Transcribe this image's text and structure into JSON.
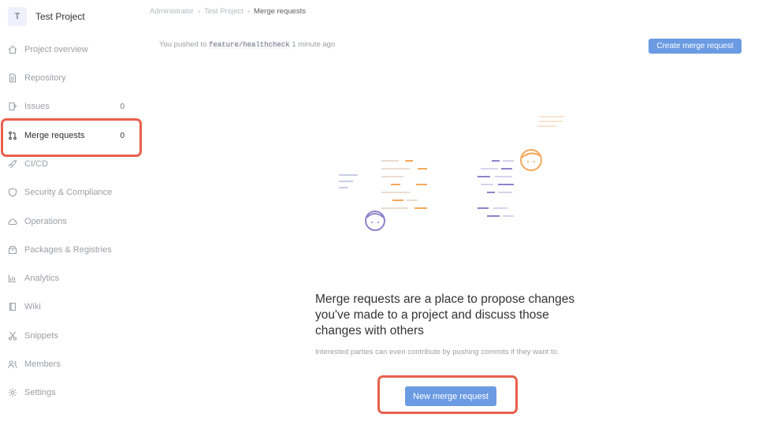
{
  "project": {
    "initial": "T",
    "name": "Test Project"
  },
  "sidebar": {
    "items": [
      {
        "label": "Project overview",
        "icon": "home-icon"
      },
      {
        "label": "Repository",
        "icon": "file-icon"
      },
      {
        "label": "Issues",
        "count": "0",
        "icon": "issues-icon"
      },
      {
        "label": "Merge requests",
        "count": "0",
        "icon": "merge-request-icon",
        "active": true
      },
      {
        "label": "CI/CD",
        "icon": "rocket-icon"
      },
      {
        "label": "Security & Compliance",
        "icon": "shield-icon"
      },
      {
        "label": "Operations",
        "icon": "cloud-icon"
      },
      {
        "label": "Packages & Registries",
        "icon": "package-icon"
      },
      {
        "label": "Analytics",
        "icon": "chart-icon"
      },
      {
        "label": "Wiki",
        "icon": "book-icon"
      },
      {
        "label": "Snippets",
        "icon": "scissors-icon"
      },
      {
        "label": "Members",
        "icon": "users-icon"
      },
      {
        "label": "Settings",
        "icon": "gear-icon"
      }
    ]
  },
  "breadcrumb": {
    "group": "Administrator",
    "project": "Test Project",
    "current": "Merge requests"
  },
  "push_note": {
    "prefix": "You pushed to",
    "branch": "feature/healthcheck",
    "suffix": "1 minute ago"
  },
  "buttons": {
    "create_mr": "Create merge request",
    "new_mr": "New merge request"
  },
  "empty_state": {
    "title": "Merge requests are a place to propose changes you've made to a project and discuss those changes with others",
    "description": "Interested parties can even contribute by pushing commits if they want to."
  },
  "colors": {
    "accent": "#6b9be3",
    "highlight": "#e8604c",
    "illustration_orange": "#f5a85c",
    "illustration_purple": "#8b84c9"
  }
}
